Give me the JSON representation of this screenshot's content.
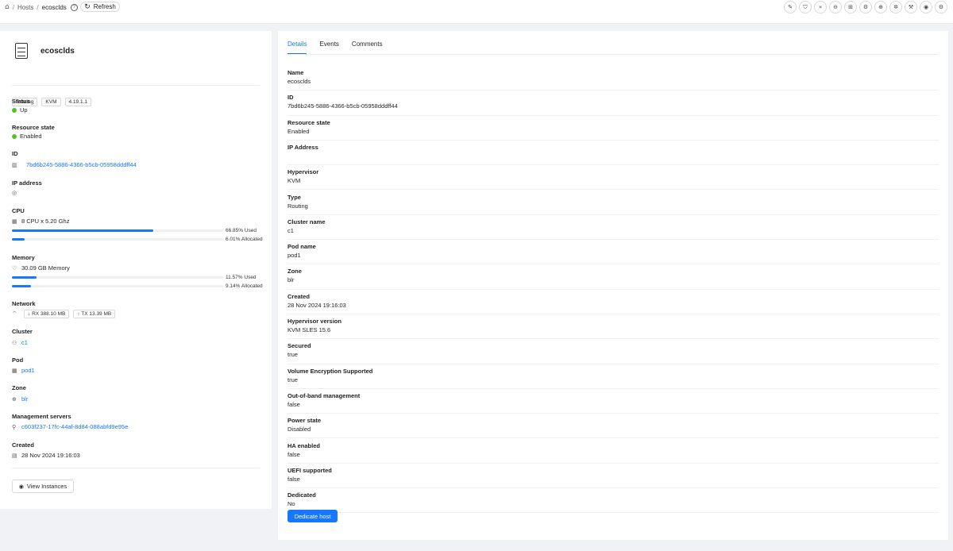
{
  "breadcrumb": {
    "home_icon": "home-icon",
    "hosts": "Hosts",
    "current": "ecosclds",
    "help_icon": "question-icon"
  },
  "toolbar": {
    "refresh_label": "Refresh",
    "action_icons": [
      "edit-icon",
      "shield-icon",
      "forward-icon",
      "stop-icon",
      "maintenance-icon",
      "settings-icon",
      "plus-circle-icon",
      "gear-icon",
      "wrench-icon",
      "eye-icon",
      "cog-icon"
    ]
  },
  "host": {
    "name": "ecosclds",
    "tags": [
      "Routing",
      "KVM",
      "4.19.1.1"
    ],
    "status": {
      "label": "Status",
      "value": "Up"
    },
    "resource_state": {
      "label": "Resource state",
      "value": "Enabled"
    },
    "id": {
      "label": "ID",
      "value": "7bd6b245-5886-4366-b5cb-05958dddff44"
    },
    "ip": {
      "label": "IP address",
      "value": ""
    },
    "cpu": {
      "label": "CPU",
      "value": "8 CPU x 5.20 Ghz",
      "used_pct": 66.85,
      "used_label": "66.85% Used",
      "alloc_pct": 6.01,
      "alloc_label": "6.01% Allocated"
    },
    "memory": {
      "label": "Memory",
      "value": "30.09 GB Memory",
      "used_pct": 11.57,
      "used_label": "11.57% Used",
      "alloc_pct": 9.14,
      "alloc_label": "9.14% Allocated"
    },
    "network": {
      "label": "Network",
      "rx": "RX 388.10 MB",
      "tx": "TX 13.39 MB"
    },
    "cluster": {
      "label": "Cluster",
      "value": "c1"
    },
    "pod": {
      "label": "Pod",
      "value": "pod1"
    },
    "zone": {
      "label": "Zone",
      "value": "blr"
    },
    "mgmt": {
      "label": "Management servers",
      "value": "c603f237-17fc-44af-8d84-088abfd9e95e"
    },
    "created": {
      "label": "Created",
      "value": "28 Nov 2024 19:16:03"
    },
    "view_instances": "View Instances"
  },
  "tabs": [
    "Details",
    "Events",
    "Comments"
  ],
  "details": [
    {
      "k": "Name",
      "v": "ecosclds"
    },
    {
      "k": "ID",
      "v": "7bd6b245-5886-4366-b5cb-05958dddff44"
    },
    {
      "k": "Resource state",
      "v": "Enabled"
    },
    {
      "k": "IP Address",
      "v": ""
    },
    {
      "k": "Hypervisor",
      "v": "KVM"
    },
    {
      "k": "Type",
      "v": "Routing"
    },
    {
      "k": "Cluster name",
      "v": "c1"
    },
    {
      "k": "Pod name",
      "v": "pod1"
    },
    {
      "k": "Zone",
      "v": "blr"
    },
    {
      "k": "Created",
      "v": "28 Nov 2024 19:16:03"
    },
    {
      "k": "Hypervisor version",
      "v": "KVM SLES 15.6"
    },
    {
      "k": "Secured",
      "v": "true"
    },
    {
      "k": "Volume Encryption Supported",
      "v": "true"
    },
    {
      "k": "Out-of-band management",
      "v": "false"
    },
    {
      "k": "Power state",
      "v": "Disabled"
    },
    {
      "k": "HA enabled",
      "v": "false"
    },
    {
      "k": "UEFI supported",
      "v": "false"
    },
    {
      "k": "Dedicated",
      "v": "No"
    }
  ],
  "dedicate_label": "Dedicate host"
}
